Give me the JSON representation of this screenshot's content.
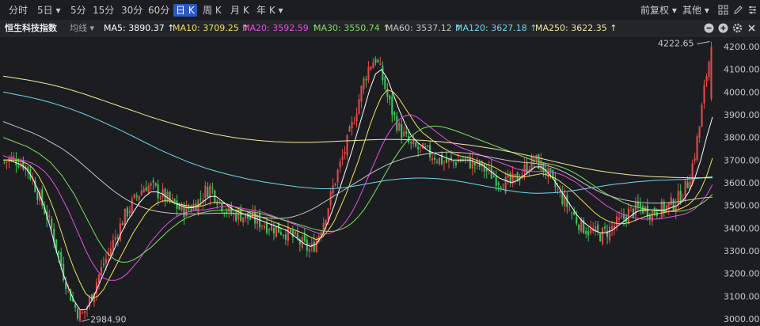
{
  "toolbar": {
    "tabs": [
      {
        "label": "分时",
        "active": false
      },
      {
        "label": "5日",
        "active": false,
        "dropdown": true
      },
      {
        "label": "5分",
        "active": false
      },
      {
        "label": "15分",
        "active": false
      },
      {
        "label": "30分",
        "active": false
      },
      {
        "label": "60分",
        "active": false
      },
      {
        "label": "日 K",
        "active": true
      },
      {
        "label": "周 K",
        "active": false
      },
      {
        "label": "月 K",
        "active": false
      },
      {
        "label": "年 K",
        "active": false,
        "dropdown": true
      }
    ],
    "adjust_label": "前复权",
    "other_label": "其他",
    "icons": [
      "grid-icon",
      "pencil-icon",
      "settings-icon"
    ]
  },
  "ma_bar": {
    "title": "恒生科技指数",
    "indicator_label": "均线",
    "items": [
      {
        "text": "MA5: 3890.37 ↑",
        "color": "#ffffff"
      },
      {
        "text": "MA10: 3709.25 ↑",
        "color": "#f0e25a"
      },
      {
        "text": "MA20: 3592.59 ↑",
        "color": "#e64fe6"
      },
      {
        "text": "MA30: 3550.74 ↑",
        "color": "#7ee060"
      },
      {
        "text": "MA60: 3537.12 ↑",
        "color": "#c5c5c5"
      },
      {
        "text": "MA120: 3627.18 ↑",
        "color": "#6fd8ec"
      },
      {
        "text": "MA250: 3622.35 ↑",
        "color": "#f3eaa0"
      }
    ],
    "icons": [
      "minus-circle-icon",
      "plus-circle-icon",
      "gear-icon",
      "close-icon"
    ]
  },
  "chart_data": {
    "type": "candlestick",
    "y_axis": {
      "min": 3000,
      "max": 4200,
      "ticks": [
        "4200.00",
        "4100.00",
        "4000.00",
        "3900.00",
        "3800.00",
        "3700.00",
        "3600.00",
        "3500.00",
        "3400.00",
        "3300.00",
        "3200.00",
        "3100.00",
        "3000.00"
      ]
    },
    "annotations": [
      {
        "label": "4222.65",
        "type": "high"
      },
      {
        "label": "2984.90",
        "type": "low"
      }
    ],
    "colors": {
      "up": "#e04b4b",
      "down": "#3fc25a"
    },
    "close_path": [
      3690,
      3710,
      3700,
      3690,
      3660,
      3600,
      3530,
      3470,
      3400,
      3300,
      3200,
      3120,
      3050,
      3010,
      3050,
      3120,
      3190,
      3250,
      3310,
      3370,
      3430,
      3480,
      3520,
      3560,
      3590,
      3580,
      3560,
      3540,
      3520,
      3500,
      3480,
      3480,
      3500,
      3520,
      3560,
      3580,
      3540,
      3500,
      3470,
      3460,
      3460,
      3450,
      3440,
      3430,
      3420,
      3410,
      3400,
      3390,
      3380,
      3360,
      3340,
      3320,
      3300,
      3350,
      3420,
      3500,
      3600,
      3680,
      3760,
      3850,
      3950,
      4050,
      4120,
      4150,
      4080,
      3980,
      3900,
      3840,
      3800,
      3760,
      3750,
      3740,
      3730,
      3720,
      3700,
      3690,
      3690,
      3700,
      3700,
      3690,
      3680,
      3670,
      3650,
      3630,
      3610,
      3600,
      3600,
      3620,
      3650,
      3680,
      3700,
      3680,
      3650,
      3600,
      3560,
      3520,
      3480,
      3440,
      3410,
      3390,
      3380,
      3370,
      3380,
      3400,
      3420,
      3440,
      3470,
      3480,
      3490,
      3480,
      3470,
      3480,
      3490,
      3500,
      3520,
      3550,
      3600,
      3700,
      3850,
      4050,
      4200
    ],
    "moving_averages": [
      {
        "name": "MA5",
        "color": "#ffffff",
        "values": [
          3700,
          3700,
          3690,
          3680,
          3660,
          3620,
          3560,
          3490,
          3400,
          3300,
          3210,
          3140,
          3080,
          3040,
          3040,
          3080,
          3140,
          3200,
          3260,
          3320,
          3380,
          3430,
          3470,
          3510,
          3540,
          3560,
          3560,
          3550,
          3530,
          3510,
          3500,
          3490,
          3490,
          3500,
          3520,
          3540,
          3540,
          3520,
          3500,
          3480,
          3470,
          3460,
          3450,
          3440,
          3430,
          3420,
          3410,
          3400,
          3390,
          3370,
          3350,
          3330,
          3320,
          3330,
          3370,
          3430,
          3500,
          3580,
          3660,
          3740,
          3830,
          3920,
          4010,
          4080,
          4100,
          4060,
          3990,
          3920,
          3860,
          3810,
          3780,
          3760,
          3740,
          3730,
          3720,
          3710,
          3700,
          3700,
          3700,
          3700,
          3690,
          3680,
          3660,
          3640,
          3620,
          3610,
          3600,
          3610,
          3630,
          3650,
          3670,
          3670,
          3650,
          3620,
          3580,
          3540,
          3500,
          3460,
          3430,
          3410,
          3390,
          3380,
          3380,
          3390,
          3410,
          3430,
          3450,
          3470,
          3480,
          3480,
          3480,
          3480,
          3480,
          3490,
          3500,
          3520,
          3560,
          3620,
          3700,
          3800,
          3890
        ]
      },
      {
        "name": "MA10",
        "color": "#f0e25a",
        "values": [
          3700,
          3700,
          3700,
          3695,
          3685,
          3665,
          3630,
          3580,
          3520,
          3450,
          3370,
          3290,
          3220,
          3160,
          3110,
          3090,
          3100,
          3130,
          3180,
          3230,
          3280,
          3330,
          3380,
          3420,
          3460,
          3490,
          3510,
          3520,
          3520,
          3510,
          3505,
          3500,
          3495,
          3495,
          3500,
          3510,
          3515,
          3510,
          3505,
          3495,
          3485,
          3475,
          3465,
          3455,
          3445,
          3435,
          3425,
          3415,
          3405,
          3395,
          3385,
          3375,
          3360,
          3350,
          3360,
          3390,
          3430,
          3490,
          3550,
          3620,
          3690,
          3770,
          3850,
          3920,
          3980,
          4010,
          4000,
          3970,
          3930,
          3890,
          3850,
          3820,
          3800,
          3780,
          3760,
          3745,
          3730,
          3720,
          3715,
          3710,
          3700,
          3690,
          3680,
          3670,
          3655,
          3640,
          3630,
          3625,
          3625,
          3630,
          3635,
          3640,
          3635,
          3625,
          3610,
          3590,
          3570,
          3545,
          3520,
          3495,
          3470,
          3450,
          3435,
          3425,
          3420,
          3420,
          3425,
          3435,
          3445,
          3455,
          3460,
          3465,
          3470,
          3475,
          3480,
          3490,
          3505,
          3530,
          3570,
          3630,
          3709
        ]
      },
      {
        "name": "MA20",
        "color": "#e64fe6",
        "values": [
          3720,
          3710,
          3705,
          3700,
          3695,
          3685,
          3670,
          3650,
          3620,
          3580,
          3530,
          3480,
          3420,
          3360,
          3300,
          3250,
          3210,
          3180,
          3170,
          3170,
          3180,
          3200,
          3230,
          3260,
          3300,
          3340,
          3370,
          3400,
          3425,
          3445,
          3460,
          3470,
          3475,
          3480,
          3480,
          3485,
          3490,
          3495,
          3495,
          3495,
          3490,
          3485,
          3480,
          3475,
          3470,
          3460,
          3450,
          3440,
          3430,
          3420,
          3410,
          3400,
          3390,
          3380,
          3375,
          3375,
          3385,
          3400,
          3430,
          3470,
          3520,
          3580,
          3640,
          3700,
          3760,
          3810,
          3850,
          3880,
          3895,
          3900,
          3890,
          3870,
          3850,
          3830,
          3810,
          3790,
          3775,
          3760,
          3750,
          3740,
          3730,
          3720,
          3710,
          3700,
          3690,
          3680,
          3670,
          3660,
          3655,
          3650,
          3650,
          3650,
          3650,
          3645,
          3640,
          3630,
          3615,
          3600,
          3580,
          3560,
          3540,
          3520,
          3500,
          3485,
          3470,
          3460,
          3450,
          3445,
          3440,
          3440,
          3440,
          3440,
          3445,
          3450,
          3455,
          3460,
          3470,
          3485,
          3510,
          3545,
          3592
        ]
      },
      {
        "name": "MA30",
        "color": "#7ee060",
        "values": [
          3800,
          3790,
          3780,
          3770,
          3760,
          3745,
          3730,
          3710,
          3690,
          3660,
          3630,
          3590,
          3550,
          3500,
          3450,
          3400,
          3350,
          3310,
          3280,
          3260,
          3250,
          3250,
          3260,
          3275,
          3295,
          3315,
          3340,
          3365,
          3390,
          3410,
          3430,
          3445,
          3455,
          3465,
          3470,
          3475,
          3478,
          3480,
          3480,
          3480,
          3478,
          3475,
          3472,
          3468,
          3462,
          3455,
          3448,
          3440,
          3432,
          3424,
          3416,
          3408,
          3400,
          3393,
          3388,
          3385,
          3387,
          3393,
          3405,
          3422,
          3448,
          3480,
          3520,
          3565,
          3610,
          3655,
          3700,
          3740,
          3775,
          3805,
          3825,
          3840,
          3848,
          3850,
          3848,
          3842,
          3834,
          3825,
          3815,
          3805,
          3795,
          3785,
          3775,
          3765,
          3755,
          3745,
          3735,
          3725,
          3715,
          3705,
          3697,
          3690,
          3685,
          3680,
          3673,
          3664,
          3652,
          3638,
          3622,
          3604,
          3586,
          3568,
          3552,
          3538,
          3525,
          3512,
          3502,
          3494,
          3488,
          3483,
          3479,
          3476,
          3474,
          3473,
          3474,
          3476,
          3482,
          3492,
          3506,
          3524,
          3550
        ]
      },
      {
        "name": "MA60",
        "color": "#c5c5c5",
        "values": [
          3870,
          3860,
          3850,
          3840,
          3830,
          3820,
          3808,
          3795,
          3780,
          3765,
          3750,
          3732,
          3712,
          3690,
          3668,
          3645,
          3622,
          3600,
          3578,
          3558,
          3540,
          3524,
          3510,
          3498,
          3488,
          3480,
          3474,
          3470,
          3467,
          3465,
          3464,
          3463,
          3463,
          3463,
          3464,
          3465,
          3466,
          3466,
          3466,
          3465,
          3463,
          3460,
          3456,
          3452,
          3448,
          3445,
          3443,
          3443,
          3445,
          3450,
          3458,
          3468,
          3480,
          3494,
          3510,
          3526,
          3542,
          3558,
          3574,
          3590,
          3606,
          3622,
          3638,
          3653,
          3667,
          3680,
          3691,
          3700,
          3708,
          3715,
          3720,
          3725,
          3729,
          3732,
          3734,
          3735,
          3735,
          3734,
          3732,
          3729,
          3725,
          3720,
          3715,
          3710,
          3705,
          3700,
          3696,
          3693,
          3690,
          3688,
          3685,
          3682,
          3676,
          3668,
          3658,
          3646,
          3632,
          3617,
          3601,
          3586,
          3572,
          3559,
          3548,
          3539,
          3531,
          3525,
          3520,
          3516,
          3513,
          3511,
          3510,
          3510,
          3511,
          3513,
          3516,
          3520,
          3524,
          3528,
          3532,
          3535,
          3537
        ]
      },
      {
        "name": "MA120",
        "color": "#6fd8ec",
        "values": [
          4000,
          3995,
          3990,
          3985,
          3980,
          3974,
          3968,
          3961,
          3954,
          3946,
          3938,
          3929,
          3920,
          3910,
          3900,
          3889,
          3878,
          3866,
          3854,
          3842,
          3830,
          3817,
          3804,
          3791,
          3778,
          3765,
          3752,
          3740,
          3728,
          3717,
          3706,
          3695,
          3685,
          3676,
          3667,
          3659,
          3651,
          3644,
          3637,
          3631,
          3625,
          3619,
          3614,
          3609,
          3604,
          3600,
          3596,
          3592,
          3588,
          3585,
          3582,
          3579,
          3577,
          3575,
          3574,
          3574,
          3575,
          3577,
          3580,
          3584,
          3588,
          3593,
          3598,
          3602,
          3607,
          3611,
          3614,
          3617,
          3619,
          3620,
          3621,
          3621,
          3620,
          3619,
          3617,
          3614,
          3611,
          3607,
          3603,
          3598,
          3593,
          3588,
          3583,
          3578,
          3573,
          3568,
          3564,
          3560,
          3557,
          3555,
          3554,
          3554,
          3555,
          3556,
          3558,
          3561,
          3564,
          3568,
          3572,
          3576,
          3580,
          3584,
          3588,
          3592,
          3595,
          3598,
          3601,
          3604,
          3606,
          3608,
          3610,
          3611,
          3612,
          3613,
          3614,
          3615,
          3617,
          3619,
          3621,
          3624,
          3627
        ]
      },
      {
        "name": "MA250",
        "color": "#f3eaa0",
        "values": [
          4070,
          4066,
          4062,
          4058,
          4054,
          4049,
          4044,
          4039,
          4033,
          4027,
          4020,
          4013,
          4005,
          3997,
          3989,
          3980,
          3971,
          3962,
          3953,
          3944,
          3935,
          3926,
          3917,
          3908,
          3899,
          3890,
          3882,
          3874,
          3866,
          3858,
          3851,
          3844,
          3837,
          3831,
          3825,
          3819,
          3814,
          3809,
          3804,
          3800,
          3796,
          3793,
          3790,
          3787,
          3785,
          3783,
          3781,
          3780,
          3779,
          3778,
          3778,
          3778,
          3778,
          3779,
          3780,
          3781,
          3782,
          3784,
          3785,
          3786,
          3787,
          3788,
          3789,
          3790,
          3791,
          3791,
          3791,
          3791,
          3790,
          3789,
          3788,
          3787,
          3785,
          3783,
          3781,
          3778,
          3775,
          3772,
          3769,
          3766,
          3762,
          3758,
          3754,
          3750,
          3745,
          3740,
          3735,
          3730,
          3725,
          3719,
          3713,
          3707,
          3701,
          3695,
          3689,
          3683,
          3677,
          3671,
          3666,
          3661,
          3656,
          3652,
          3648,
          3644,
          3641,
          3638,
          3635,
          3633,
          3631,
          3629,
          3627,
          3626,
          3625,
          3624,
          3623,
          3623,
          3622,
          3622,
          3622,
          3622,
          3622
        ]
      }
    ]
  }
}
